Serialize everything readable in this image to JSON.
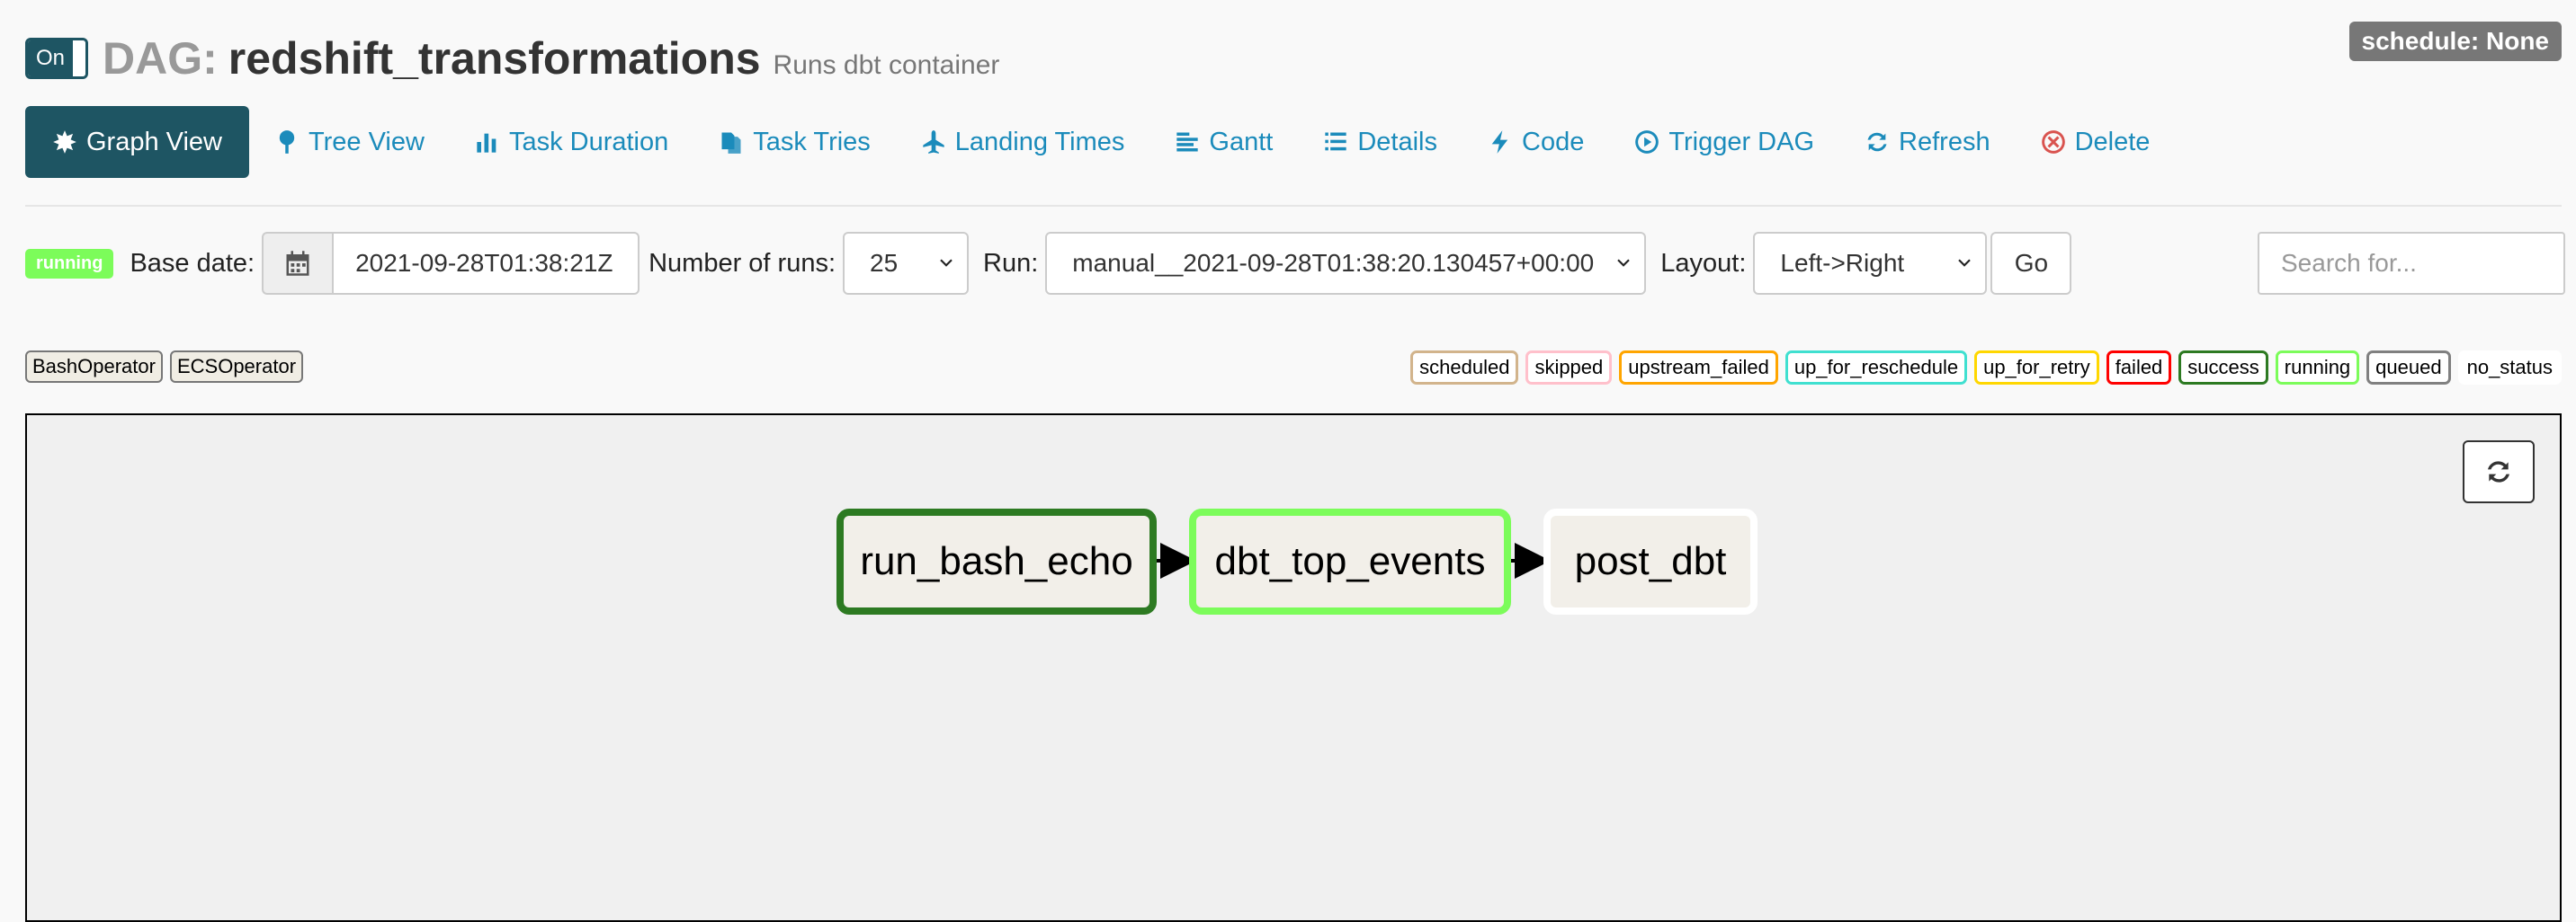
{
  "header": {
    "toggle_label": "On",
    "dag_prefix": "DAG:",
    "dag_name": "redshift_transformations",
    "description": "Runs dbt container",
    "schedule": "schedule: None"
  },
  "nav": {
    "items": [
      {
        "label": "Graph View",
        "icon": "burst-icon"
      },
      {
        "label": "Tree View",
        "icon": "tree-icon"
      },
      {
        "label": "Task Duration",
        "icon": "bar-chart-icon"
      },
      {
        "label": "Task Tries",
        "icon": "files-icon"
      },
      {
        "label": "Landing Times",
        "icon": "plane-icon"
      },
      {
        "label": "Gantt",
        "icon": "gantt-icon"
      },
      {
        "label": "Details",
        "icon": "list-icon"
      },
      {
        "label": "Code",
        "icon": "bolt-icon"
      },
      {
        "label": "Trigger DAG",
        "icon": "play-circle-icon"
      },
      {
        "label": "Refresh",
        "icon": "refresh-icon"
      },
      {
        "label": "Delete",
        "icon": "x-circle-icon"
      }
    ]
  },
  "controls": {
    "state_label": "running",
    "base_date_label": "Base date:",
    "base_date_value": "2021-09-28T01:38:21Z",
    "num_runs_label": "Number of runs:",
    "num_runs_value": "25",
    "run_label": "Run:",
    "run_value": "manual__2021-09-28T01:38:20.130457+00:00",
    "layout_label": "Layout:",
    "layout_value": "Left->Right",
    "go_label": "Go",
    "search_placeholder": "Search for..."
  },
  "operators": [
    "BashOperator",
    "ECSOperator"
  ],
  "legend": [
    {
      "label": "scheduled",
      "color": "#d2b48c"
    },
    {
      "label": "skipped",
      "color": "#ffc0cb"
    },
    {
      "label": "upstream_failed",
      "color": "#ffa500"
    },
    {
      "label": "up_for_reschedule",
      "color": "#40e0d0"
    },
    {
      "label": "up_for_retry",
      "color": "#ffd700"
    },
    {
      "label": "failed",
      "color": "#ff0000"
    },
    {
      "label": "success",
      "color": "#2d7a22"
    },
    {
      "label": "running",
      "color": "#7cfc5a"
    },
    {
      "label": "queued",
      "color": "#808080"
    },
    {
      "label": "no_status",
      "color": "transparent"
    }
  ],
  "graph": {
    "nodes": [
      {
        "label": "run_bash_echo",
        "state": "success"
      },
      {
        "label": "dbt_top_events",
        "state": "running"
      },
      {
        "label": "post_dbt",
        "state": "no_status"
      }
    ]
  }
}
